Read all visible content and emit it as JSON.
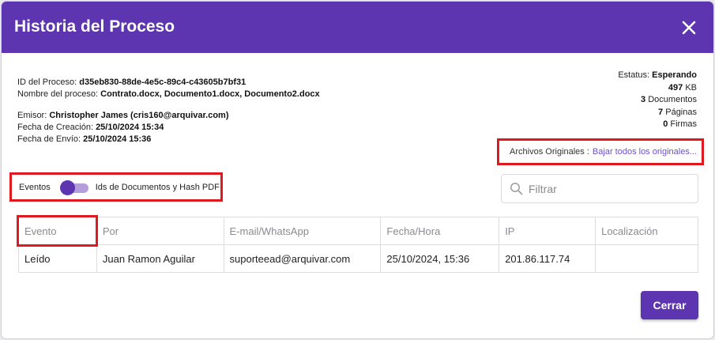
{
  "dialog": {
    "title": "Historia del Proceso",
    "close_icon": "close-icon"
  },
  "info": {
    "id_label": "ID del Proceso:",
    "id_value": "d35eb830-88de-4e5c-89c4-c43605b7bf31",
    "nombre_label": "Nombre del proceso:",
    "nombre_value": "Contrato.docx, Documento1.docx, Documento2.docx",
    "emisor_label": "Emisor:",
    "emisor_value": "Christopher James (cris160@arquivar.com)",
    "creacion_label": "Fecha de Creación:",
    "creacion_value": "25/10/2024 15:34",
    "envio_label": "Fecha de Envío:",
    "envio_value": "25/10/2024 15:36"
  },
  "summary": {
    "estatus_label": "Estatus:",
    "estatus_value": "Esperando",
    "size_value": "497",
    "size_unit": "KB",
    "docs_value": "3",
    "docs_label": "Documentos",
    "pages_value": "7",
    "pages_label": "Páginas",
    "firmas_value": "0",
    "firmas_label": "Firmas"
  },
  "archivos": {
    "label": "Archivos Originales :",
    "link": "Bajar todos los originales..."
  },
  "toggle": {
    "left_label": "Eventos",
    "right_label": "Ids de Documentos y Hash PDF",
    "state": "off"
  },
  "filter": {
    "placeholder": "Filtrar",
    "icon": "search-icon"
  },
  "table": {
    "headers": [
      "Evento",
      "Por",
      "E-mail/WhatsApp",
      "Fecha/Hora",
      "IP",
      "Localización"
    ],
    "rows": [
      [
        "Leído",
        "Juan Ramon Aguilar",
        "suporteead@arquivar.com",
        "25/10/2024, 15:36",
        "201.86.117.74",
        ""
      ]
    ]
  },
  "footer": {
    "cerrar_label": "Cerrar"
  },
  "colors": {
    "brand": "#5e35b1",
    "toggle_track": "#b39ddb",
    "highlight": "#e0191e",
    "link": "#6c4ccf"
  }
}
